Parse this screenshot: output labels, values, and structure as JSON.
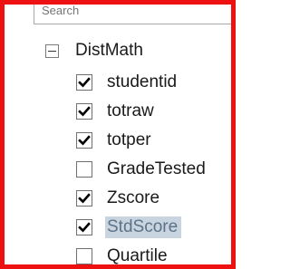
{
  "search": {
    "placeholder": "Search"
  },
  "tree": {
    "group": {
      "label": "DistMath",
      "expanded": true
    },
    "fields": [
      {
        "label": "studentid",
        "checked": true,
        "highlighted": false
      },
      {
        "label": "totraw",
        "checked": true,
        "highlighted": false
      },
      {
        "label": "totper",
        "checked": true,
        "highlighted": false
      },
      {
        "label": "GradeTested",
        "checked": false,
        "highlighted": false
      },
      {
        "label": "Zscore",
        "checked": true,
        "highlighted": false
      },
      {
        "label": "StdScore",
        "checked": true,
        "highlighted": true
      },
      {
        "label": "Quartile",
        "checked": false,
        "highlighted": false
      }
    ]
  },
  "colors": {
    "frame_border": "#ee1111",
    "highlight": "#c8d4e0"
  }
}
